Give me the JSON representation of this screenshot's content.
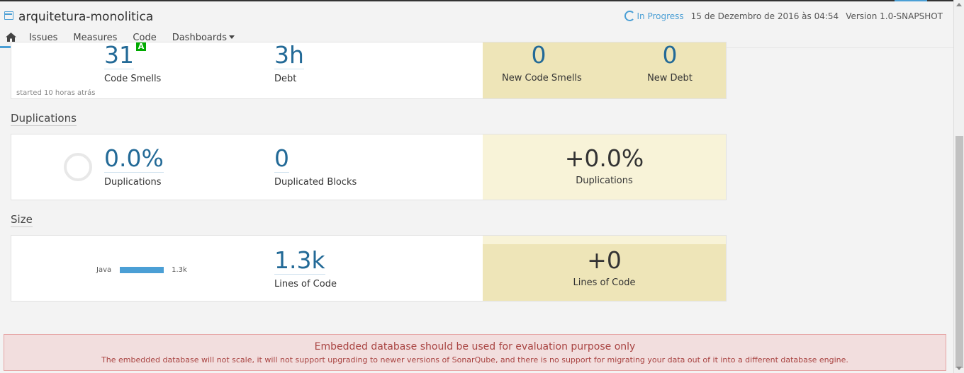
{
  "header": {
    "project_title": "arquitetura-monolitica",
    "status": "In Progress",
    "date": "15 de Dezembro de 2016 às 04:54",
    "version": "Version 1.0-SNAPSHOT"
  },
  "nav": {
    "items": [
      {
        "label": "Issues"
      },
      {
        "label": "Measures"
      },
      {
        "label": "Code"
      },
      {
        "label": "Dashboards"
      }
    ]
  },
  "maintainability": {
    "code_smells": {
      "value": "31",
      "label": "Code Smells",
      "rating": "A"
    },
    "debt": {
      "value": "3h",
      "label": "Debt"
    },
    "started": "started 10 horas atrás",
    "new_code_smells": {
      "value": "0",
      "label": "New Code Smells"
    },
    "new_debt": {
      "value": "0",
      "label": "New Debt"
    }
  },
  "duplications": {
    "title": "Duplications",
    "duplications": {
      "value": "0.0%",
      "label": "Duplications"
    },
    "blocks": {
      "value": "0",
      "label": "Duplicated Blocks"
    },
    "new_duplications": {
      "value": "+0.0%",
      "label": "Duplications"
    }
  },
  "size": {
    "title": "Size",
    "language": {
      "name": "Java",
      "value": "1.3k"
    },
    "loc": {
      "value": "1.3k",
      "label": "Lines of Code"
    },
    "new_loc": {
      "value": "+0",
      "label": "Lines of Code"
    }
  },
  "warning": {
    "title": "Embedded database should be used for evaluation purpose only",
    "message": "The embedded database will not scale, it will not support upgrading to newer versions of SonarQube, and there is no support for migrating your data out of it into a different database engine."
  },
  "colors": {
    "accent": "#4b9fd5",
    "measure": "#236a97",
    "leak_dark": "#eee5b8",
    "leak_light": "#f8f3d8",
    "rating_a": "#00aa00",
    "warning_bg": "#f2dede",
    "warning_text": "#a94442"
  },
  "icons": {
    "project": "project-icon",
    "home": "home-icon",
    "status": "spinner-icon"
  }
}
